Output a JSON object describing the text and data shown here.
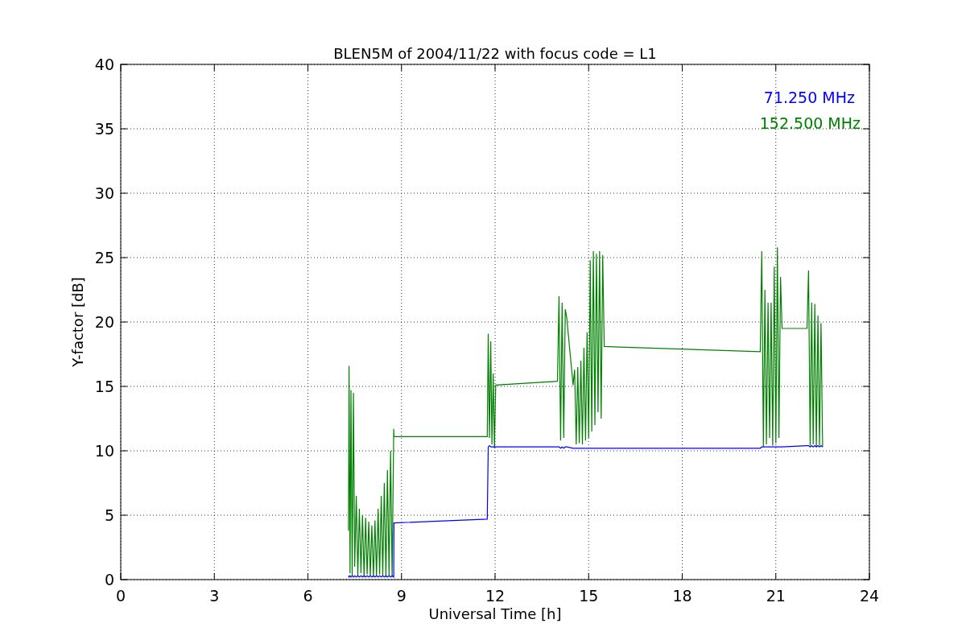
{
  "chart_data": {
    "type": "line",
    "title": "BLEN5M of 2004/11/22 with focus code = L1",
    "xlabel": "Universal Time [h]",
    "ylabel": "Y-factor [dB]",
    "xlim": [
      0,
      24
    ],
    "ylim": [
      0,
      40
    ],
    "xticks": [
      0,
      3,
      6,
      9,
      12,
      15,
      18,
      21,
      24
    ],
    "yticks": [
      0,
      5,
      10,
      15,
      20,
      25,
      30,
      35,
      40
    ],
    "grid": true,
    "x": [
      7.3,
      7.32,
      7.35,
      7.38,
      7.42,
      7.46,
      7.5,
      7.55,
      7.6,
      7.65,
      7.7,
      7.75,
      7.8,
      7.85,
      7.9,
      7.95,
      8.0,
      8.05,
      8.1,
      8.15,
      8.2,
      8.25,
      8.3,
      8.35,
      8.4,
      8.45,
      8.5,
      8.55,
      8.6,
      8.65,
      8.7,
      8.75,
      8.76,
      11.75,
      11.78,
      11.82,
      11.86,
      11.9,
      11.94,
      11.98,
      12.02,
      14.0,
      14.05,
      14.1,
      14.15,
      14.2,
      14.25,
      14.3,
      14.5,
      14.55,
      14.6,
      14.65,
      14.7,
      14.75,
      14.8,
      14.85,
      14.9,
      14.95,
      15.0,
      15.05,
      15.1,
      15.15,
      15.2,
      15.25,
      15.3,
      15.35,
      15.4,
      15.45,
      15.5,
      20.5,
      20.55,
      20.6,
      20.65,
      20.7,
      20.75,
      20.8,
      20.85,
      20.9,
      20.95,
      21.0,
      21.05,
      21.1,
      21.15,
      21.2,
      22.0,
      22.05,
      22.1,
      22.15,
      22.2,
      22.25,
      22.3,
      22.35,
      22.4,
      22.45,
      22.5
    ],
    "series": [
      {
        "name": "71.250 MHz",
        "color": "#0000ff",
        "values": [
          0.3,
          0.2,
          0.3,
          0.2,
          0.3,
          0.2,
          0.3,
          0.2,
          0.3,
          0.2,
          0.3,
          0.2,
          0.3,
          0.2,
          0.3,
          0.2,
          0.3,
          0.2,
          0.3,
          0.2,
          0.3,
          0.2,
          0.3,
          0.2,
          0.3,
          0.2,
          0.3,
          0.2,
          0.3,
          0.2,
          0.3,
          0.2,
          4.4,
          4.7,
          10.3,
          10.4,
          10.3,
          10.3,
          10.3,
          10.3,
          10.3,
          10.3,
          10.3,
          10.2,
          10.3,
          10.2,
          10.3,
          10.3,
          10.2,
          10.2,
          10.2,
          10.2,
          10.2,
          10.2,
          10.2,
          10.2,
          10.2,
          10.2,
          10.2,
          10.2,
          10.2,
          10.2,
          10.2,
          10.2,
          10.2,
          10.2,
          10.2,
          10.2,
          10.2,
          10.2,
          10.3,
          10.3,
          10.3,
          10.3,
          10.3,
          10.3,
          10.3,
          10.3,
          10.3,
          10.3,
          10.3,
          10.3,
          10.3,
          10.3,
          10.4,
          10.4,
          10.3,
          10.4,
          10.3,
          10.4,
          10.3,
          10.4,
          10.3,
          10.4,
          10.3
        ]
      },
      {
        "name": "152.500 MHz",
        "color": "#008000",
        "values": [
          3.8,
          16.6,
          0.5,
          14.7,
          0.3,
          14.5,
          1.0,
          6.5,
          0.3,
          5.5,
          0.5,
          5.0,
          0.2,
          4.8,
          0.4,
          4.5,
          0.3,
          4.2,
          0.2,
          4.6,
          0.3,
          5.5,
          0.4,
          6.5,
          0.3,
          7.5,
          0.2,
          8.5,
          0.3,
          10.0,
          0.2,
          11.7,
          11.1,
          11.1,
          19.1,
          11.0,
          18.5,
          10.5,
          16.0,
          10.2,
          15.1,
          15.4,
          22.0,
          10.8,
          21.5,
          11.0,
          21.0,
          20.3,
          15.1,
          16.3,
          10.5,
          16.5,
          10.6,
          17.0,
          10.5,
          18.0,
          10.8,
          19.2,
          11.0,
          24.8,
          11.5,
          25.5,
          12.0,
          25.3,
          13.0,
          25.5,
          12.5,
          25.2,
          18.1,
          17.7,
          25.5,
          10.3,
          22.5,
          10.5,
          21.5,
          11.0,
          21.5,
          10.4,
          24.3,
          10.6,
          25.8,
          11.0,
          23.5,
          19.5,
          19.5,
          24.0,
          10.4,
          21.5,
          10.5,
          21.4,
          10.3,
          20.5,
          10.4,
          19.9,
          10.3
        ]
      }
    ]
  }
}
